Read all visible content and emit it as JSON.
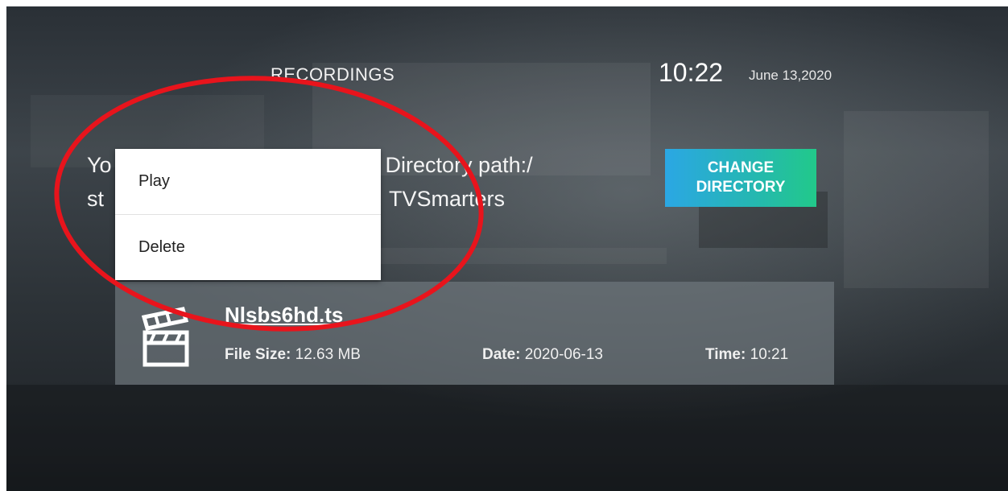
{
  "header": {
    "title": "RECORDINGS",
    "time": "10:22",
    "date": "June 13,2020"
  },
  "directory": {
    "line1_visible_start": "Yo",
    "line1_visible_end": "Directory path:/",
    "line2_visible_start": "st",
    "line2_visible_end": "TVSmarters",
    "change_button_label": "CHANGE DIRECTORY"
  },
  "context_menu": {
    "items": [
      {
        "label": "Play"
      },
      {
        "label": "Delete"
      }
    ]
  },
  "recording": {
    "name": "Nlsbs6hd.ts",
    "icon": "clapperboard-icon",
    "file_size_label": "File Size:",
    "file_size_value": "12.63 MB",
    "date_label": "Date:",
    "date_value": "2020-06-13",
    "time_label": "Time:",
    "time_value": "10:21"
  },
  "colors": {
    "accent_start": "#2ba7e4",
    "accent_end": "#22c98a",
    "annotation": "#e8141c"
  }
}
